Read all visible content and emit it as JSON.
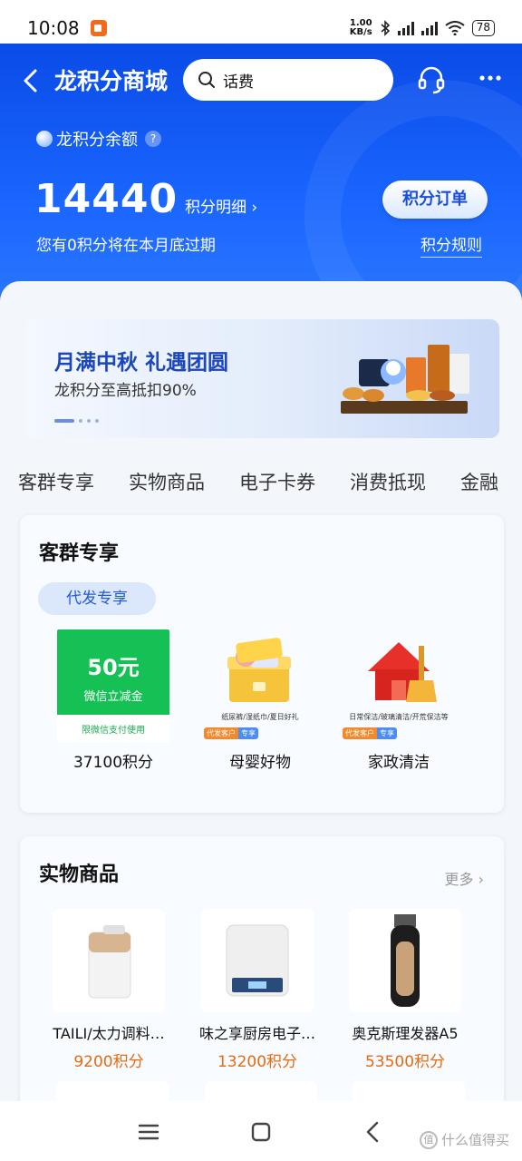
{
  "status": {
    "time": "10:08",
    "net_speed_value": "1.00",
    "net_speed_unit": "KB/s",
    "battery": "78"
  },
  "header": {
    "title": "龙积分商城",
    "search_placeholder": "话费",
    "balance_label": "龙积分余额",
    "balance": "14440",
    "detail_link": "积分明细",
    "expire_note": "您有0积分将在本月底过期",
    "order_button": "积分订单",
    "rules_link": "积分规则"
  },
  "banner": {
    "title": "月满中秋 礼遇团圆",
    "subtitle": "龙积分至高抵扣90%"
  },
  "category_tabs": [
    "客群专享",
    "实物商品",
    "电子卡券",
    "消费抵现",
    "金融"
  ],
  "exclusive": {
    "title": "客群专享",
    "pill": "代发专享",
    "items": [
      {
        "coupon_amount": "50元",
        "coupon_sub": "微信立减金",
        "coupon_note": "限微信支付使用",
        "price": "37100积分"
      },
      {
        "desc": "纸尿裤/湿纸巾/夏日好礼",
        "tag_a": "代发客户",
        "tag_b": "专享",
        "price": "母婴好物"
      },
      {
        "desc": "日常保洁/玻璃清洁/开荒保洁等",
        "tag_a": "代发客户",
        "tag_b": "专享",
        "price": "家政清洁"
      }
    ]
  },
  "physical": {
    "title": "实物商品",
    "more": "更多",
    "items": [
      {
        "name": "TAILI/太力调料…",
        "price": "9200积分"
      },
      {
        "name": "味之享厨房电子…",
        "price": "13200积分"
      },
      {
        "name": "奥克斯理发器A5",
        "price": "53500积分"
      }
    ]
  },
  "watermark": "什么值得买",
  "colors": {
    "brand_blue": "#1a66ff",
    "price_orange": "#e66b10",
    "wechat_green": "#15c155"
  }
}
